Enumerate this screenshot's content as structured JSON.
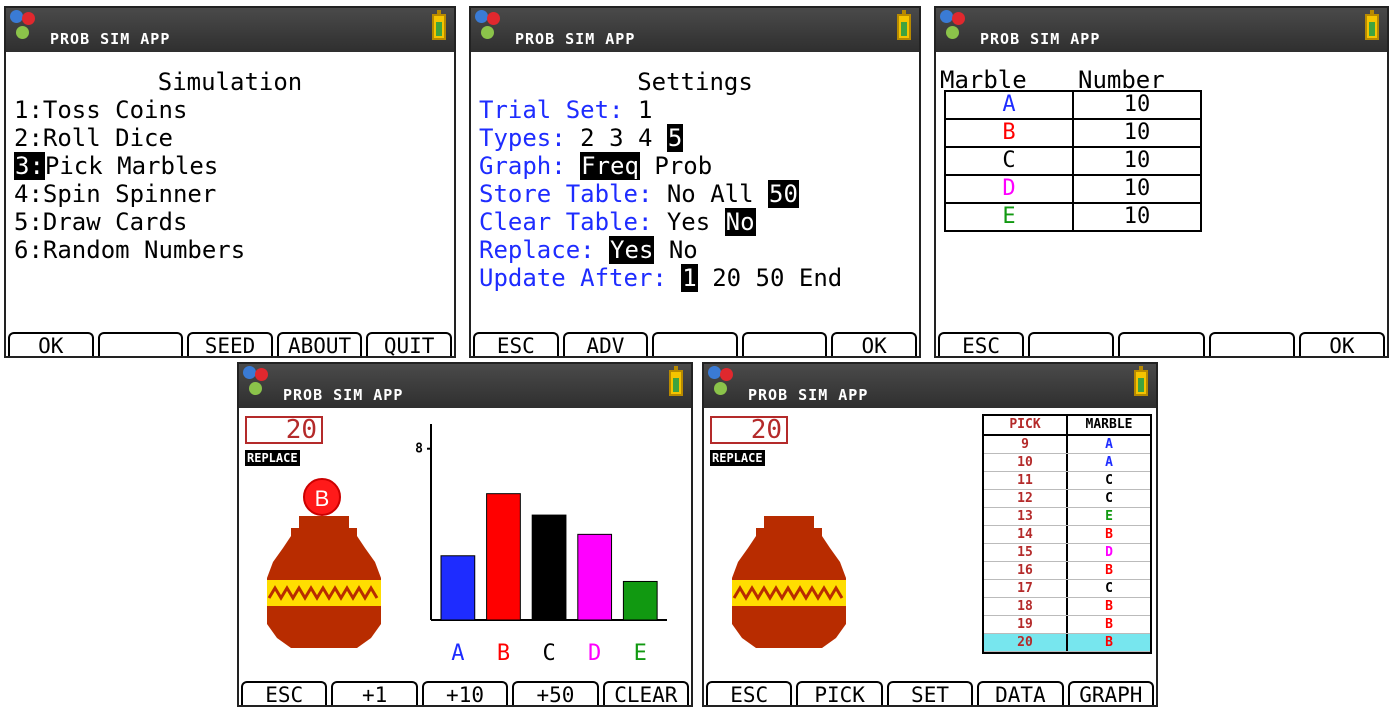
{
  "app_title": "PROB SIM APP",
  "colors": {
    "blue": "#1e2cff",
    "red": "#ff0000",
    "black": "#000000",
    "magenta": "#ff00ff",
    "green": "#119911",
    "jar": "#b82c00",
    "jar_band": "#ffdd00",
    "counter": "#b42a2a",
    "highlight": "#77e6ee"
  },
  "screen1": {
    "heading": "Simulation",
    "items": [
      {
        "num": "1:",
        "label": "Toss Coins"
      },
      {
        "num": "2:",
        "label": "Roll Dice"
      },
      {
        "num": "3:",
        "label": "Pick Marbles"
      },
      {
        "num": "4:",
        "label": "Spin Spinner"
      },
      {
        "num": "5:",
        "label": "Draw Cards"
      },
      {
        "num": "6:",
        "label": "Random Numbers"
      }
    ],
    "softkeys": [
      "OK",
      "",
      "SEED",
      "ABOUT",
      "QUIT"
    ]
  },
  "screen2": {
    "heading": "Settings",
    "trial_label": "Trial Set:",
    "trial_value": "1",
    "types_label": "Types:",
    "types_opts": [
      "2",
      "3",
      "4"
    ],
    "types_sel": "5",
    "graph_label": "Graph:",
    "graph_sel": "Freq",
    "graph_other": "Prob",
    "store_label": "Store Table:",
    "store_opts": "No All",
    "store_sel": "50",
    "clear_label": "Clear Table:",
    "clear_opt": "Yes",
    "clear_sel": "No",
    "replace_label": "Replace:",
    "replace_sel": "Yes",
    "replace_other": "No",
    "update_label": "Update After:",
    "update_sel": "1",
    "update_others": "20 50 End",
    "softkeys": [
      "ESC",
      "ADV",
      "",
      "",
      "OK"
    ]
  },
  "screen3": {
    "col1": "Marble",
    "col2": "Number",
    "rows": [
      {
        "m": "A",
        "n": "10",
        "color": "blue"
      },
      {
        "m": "B",
        "n": "10",
        "color": "red"
      },
      {
        "m": "C",
        "n": "10",
        "color": "black"
      },
      {
        "m": "D",
        "n": "10",
        "color": "magenta"
      },
      {
        "m": "E",
        "n": "10",
        "color": "green"
      }
    ],
    "softkeys": [
      "ESC",
      "",
      "",
      "",
      "OK"
    ]
  },
  "screen4": {
    "counter": "20",
    "replace_badge": "REPLACE",
    "marble_label": "B",
    "y_tick": "8",
    "softkeys": [
      "ESC",
      "+1",
      "+10",
      "+50",
      "CLEAR"
    ]
  },
  "chart_data": {
    "type": "bar",
    "categories": [
      "A",
      "B",
      "C",
      "D",
      "E"
    ],
    "values": [
      3,
      5.9,
      4.9,
      4,
      1.8
    ],
    "ylim": [
      0,
      8.5
    ],
    "y_ticks": [
      8
    ],
    "colors": [
      "#1e2cff",
      "#ff0000",
      "#000000",
      "#ff00ff",
      "#119911"
    ]
  },
  "screen5": {
    "counter": "20",
    "replace_badge": "REPLACE",
    "col_pick": "PICK",
    "col_marble": "MARBLE",
    "rows": [
      {
        "pick": "9",
        "marble": "A",
        "color": "blue"
      },
      {
        "pick": "10",
        "marble": "A",
        "color": "blue"
      },
      {
        "pick": "11",
        "marble": "C",
        "color": "black"
      },
      {
        "pick": "12",
        "marble": "C",
        "color": "black"
      },
      {
        "pick": "13",
        "marble": "E",
        "color": "green"
      },
      {
        "pick": "14",
        "marble": "B",
        "color": "red"
      },
      {
        "pick": "15",
        "marble": "D",
        "color": "magenta"
      },
      {
        "pick": "16",
        "marble": "B",
        "color": "red"
      },
      {
        "pick": "17",
        "marble": "C",
        "color": "black"
      },
      {
        "pick": "18",
        "marble": "B",
        "color": "red"
      },
      {
        "pick": "19",
        "marble": "B",
        "color": "red"
      },
      {
        "pick": "20",
        "marble": "B",
        "color": "red"
      }
    ],
    "softkeys": [
      "ESC",
      "PICK",
      "SET",
      "DATA",
      "GRAPH"
    ]
  }
}
